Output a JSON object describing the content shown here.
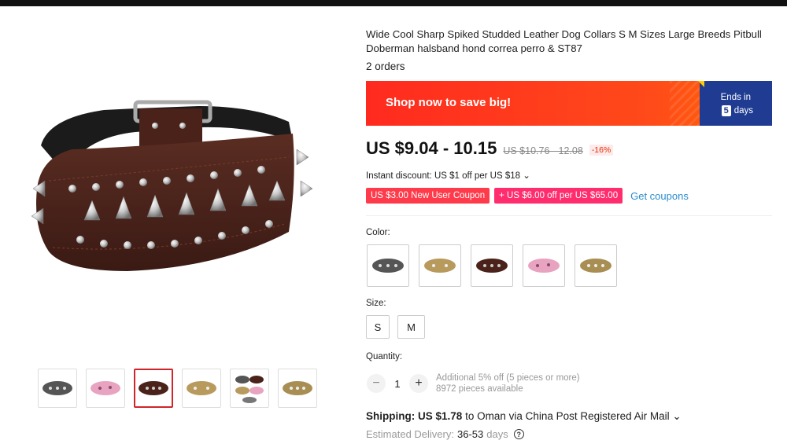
{
  "product": {
    "title": "Wide Cool Sharp Spiked Studded Leather Dog Collars S M Sizes Large Breeds Pitbull Doberman halsband hond correa perro & ST87",
    "orders": "2 orders"
  },
  "banner": {
    "text": "Shop now to save big!",
    "ends_label": "Ends in",
    "ends_number": "5",
    "ends_unit": "days",
    "colors": {
      "red": "#ff2a1f",
      "blue": "#1f3c92"
    }
  },
  "price": {
    "current": "US $9.04 - 10.15",
    "original": "US $10.76 - 12.08",
    "discount": "-16%"
  },
  "instant_discount": "Instant discount: US $1 off per US $18 ⌄",
  "coupons": {
    "new_user": "US $3.00 New User Coupon",
    "store": "+ US $6.00 off per US $65.00",
    "get_label": "Get coupons"
  },
  "color": {
    "label": "Color:",
    "options": [
      "black-silver",
      "tan-gold",
      "brown-spikes",
      "pink-leopard",
      "leopard-gold"
    ]
  },
  "size": {
    "label": "Size:",
    "options": [
      "S",
      "M"
    ]
  },
  "quantity": {
    "label": "Quantity:",
    "value": "1",
    "minus": "−",
    "plus": "+",
    "promo": "Additional 5% off (5 pieces or more)",
    "available": "8972 pieces available"
  },
  "shipping": {
    "label": "Shipping:",
    "cost": "US $1.78",
    "route": "to Oman via China Post Registered Air Mail ⌄"
  },
  "delivery": {
    "label": "Estimated Delivery:",
    "range": "36-53",
    "unit": "days",
    "help": "?"
  },
  "gallery": {
    "thumbnails": [
      "black-silver",
      "pink-leopard",
      "brown-spikes",
      "leopard-gold",
      "multi-collars",
      "leopard-gold-2"
    ],
    "active_index": 2
  }
}
